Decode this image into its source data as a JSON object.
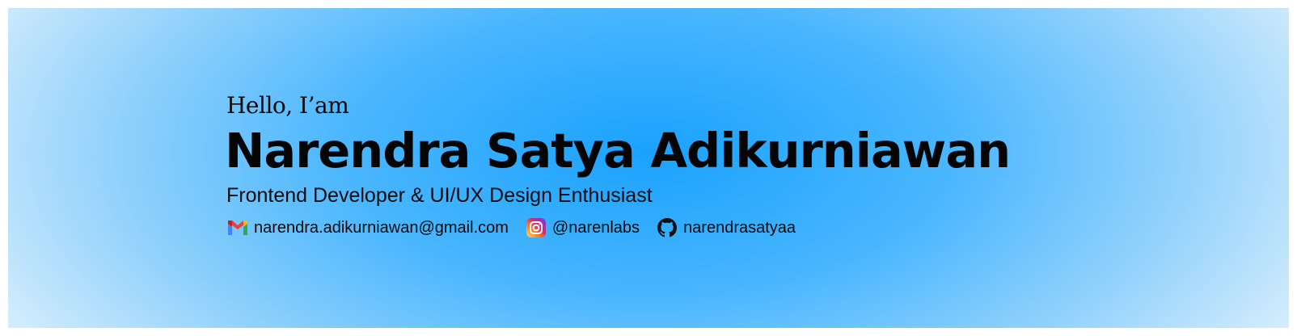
{
  "banner": {
    "greeting": "Hello, I’am",
    "name": "Narendra Satya Adikurniawan",
    "role": "Frontend Developer & UI/UX Design Enthusiast",
    "contacts": [
      {
        "icon": "gmail-icon",
        "label": "narendra.adikurniawan@gmail.com"
      },
      {
        "icon": "instagram-icon",
        "label": "@narenlabs"
      },
      {
        "icon": "github-icon",
        "label": "narendrasatyaa"
      }
    ],
    "colors": {
      "center": "#1aa2fd",
      "edge": "#e9f5fd",
      "text": "#050505"
    }
  }
}
